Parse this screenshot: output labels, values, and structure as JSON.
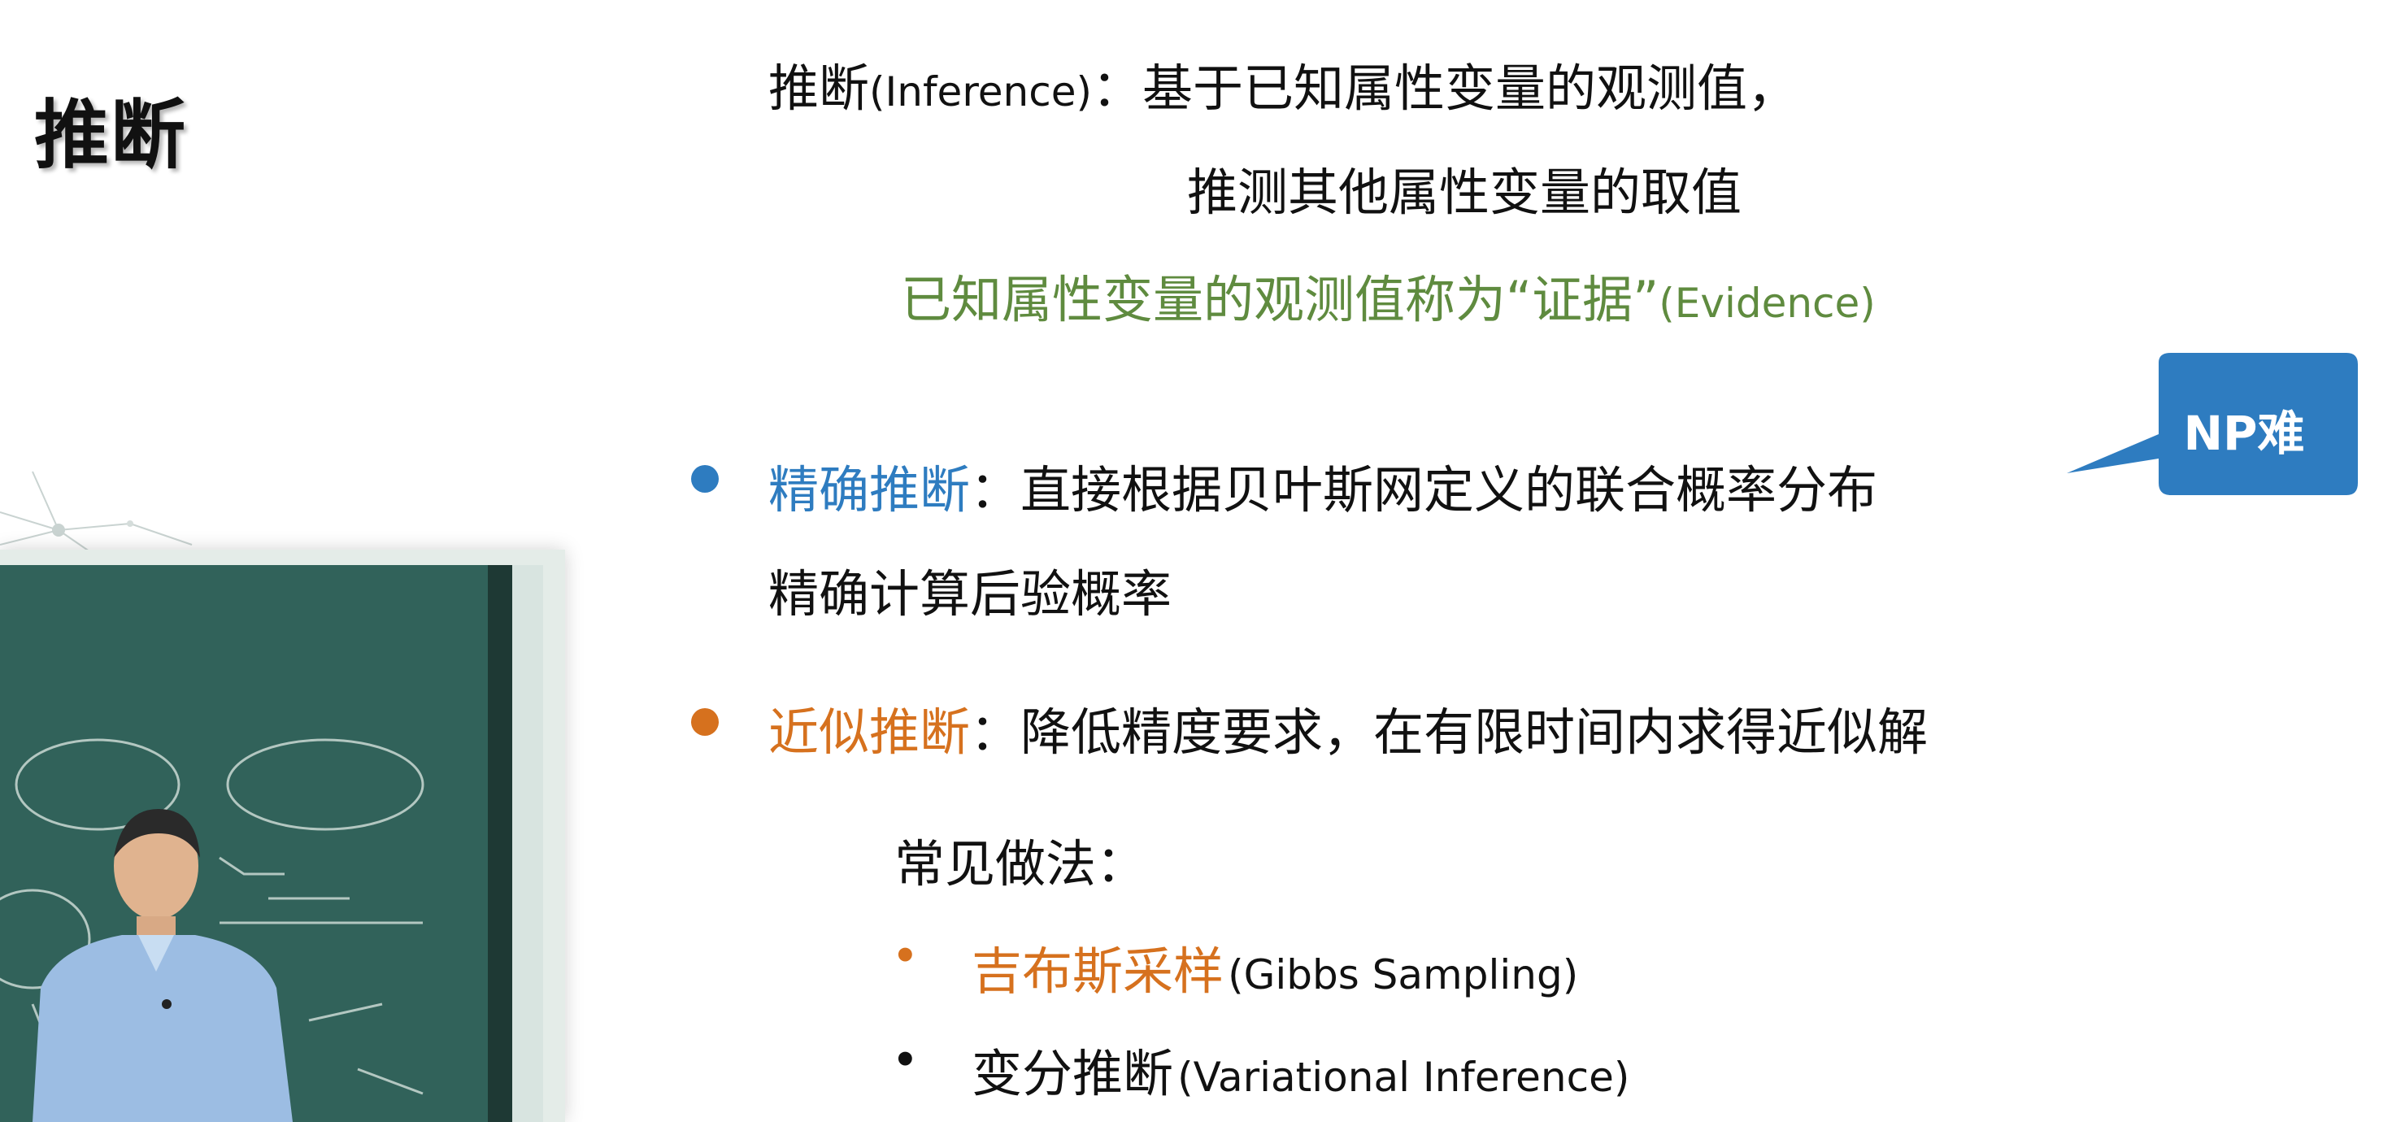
{
  "slide": {
    "title": "推断",
    "definition": {
      "term": "推断",
      "term_en": "(Inference)",
      "colon": "：",
      "text_line1": "基于已知属性变量的观测值，",
      "text_line2": "推测其他属性变量的取值"
    },
    "evidence": {
      "text": "已知属性变量的观测值称为“证据”",
      "en": "(Evidence)"
    },
    "exact_inference": {
      "term": "精确推断",
      "colon": "：",
      "text_line1": "直接根据贝叶斯网定义的联合概率分布",
      "text_line2": "精确计算后验概率"
    },
    "callout": {
      "text": "NP难"
    },
    "approx_inference": {
      "term": "近似推断",
      "colon": "：",
      "text": "降低精度要求，在有限时间内求得近似解"
    },
    "common_methods": {
      "label": "常见做法：",
      "items": [
        {
          "bullet": "•",
          "cn": "吉布斯采样",
          "en": "(Gibbs Sampling)"
        },
        {
          "bullet": "•",
          "cn": "变分推断",
          "en": "(Variational Inference)"
        }
      ]
    },
    "colors": {
      "title": "#111111",
      "green": "#5f8b3f",
      "blue": "#2e7cc0",
      "orange": "#d6711e",
      "callout": "#2e7cc0"
    }
  }
}
